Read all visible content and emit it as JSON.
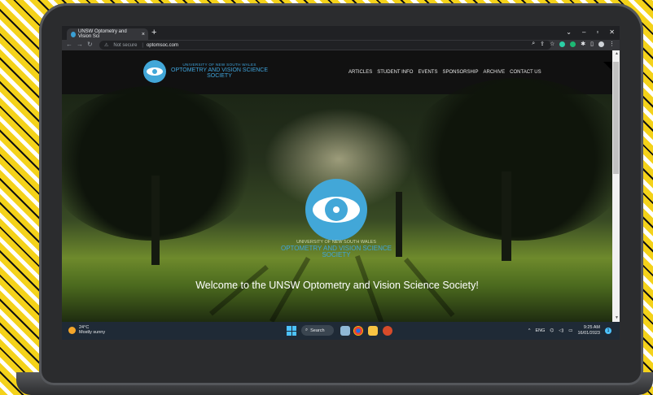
{
  "browser": {
    "tab_title": "UNSW Optometry and Vision Sci",
    "tab_close": "×",
    "new_tab": "+",
    "window_controls": [
      "⌄",
      "–",
      "▫",
      "✕"
    ],
    "security_label": "Not secure",
    "url": "optomsoc.com",
    "extension_colors": [
      "#2bd0a6",
      "#2bd0a6"
    ]
  },
  "site": {
    "logo": {
      "line1": "UNIVERSITY OF NEW SOUTH WALES",
      "line2": "OPTOMETRY AND VISION SCIENCE",
      "line3": "SOCIETY"
    },
    "menu": [
      "ARTICLES",
      "STUDENT INFO",
      "EVENTS",
      "SPONSORSHIP",
      "ARCHIVE",
      "CONTACT US"
    ],
    "hero": {
      "logo_line1": "UNIVERSITY OF NEW SOUTH WALES",
      "logo_line2": "OPTOMETRY AND VISION SCIENCE",
      "logo_line3": "SOCIETY",
      "welcome": "Welcome to the UNSW Optometry and Vision Science Society!"
    },
    "accent_color": "#42a7d8"
  },
  "taskbar": {
    "weather_temp": "24°C",
    "weather_desc": "Mostly sunny",
    "search_label": "Search",
    "language": "ENG",
    "time": "9:25 AM",
    "date": "16/01/2023",
    "notification_count": "1"
  }
}
